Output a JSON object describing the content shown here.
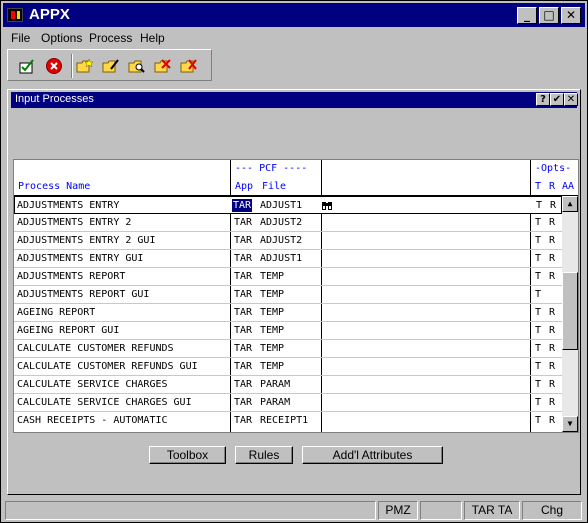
{
  "window": {
    "title": "APPX"
  },
  "menu": [
    "File",
    "Options",
    "Process",
    "Help"
  ],
  "toolbar": [
    "checkmark-icon",
    "cancel-icon",
    "folder-new-icon",
    "folder-edit-icon",
    "folder-search-icon",
    "folder-delete-icon",
    "folder-check-icon"
  ],
  "dialog": {
    "title": "Input Processes",
    "header": {
      "process_name": "Process Name",
      "pcf_group": "--- PCF ----",
      "app": "App",
      "file": "File",
      "opts_group": "-Opts-",
      "opt_t": "T",
      "opt_r": "R",
      "opt_aa": "AA"
    },
    "rows": [
      {
        "name": "ADJUSTMENTS ENTRY",
        "app": "TAR",
        "file": "ADJUST1",
        "t": "T",
        "r": "R"
      },
      {
        "name": "ADJUSTMENTS ENTRY 2",
        "app": "TAR",
        "file": "ADJUST2",
        "t": "T",
        "r": "R"
      },
      {
        "name": "ADJUSTMENTS ENTRY 2 GUI",
        "app": "TAR",
        "file": "ADJUST2",
        "t": "T",
        "r": "R"
      },
      {
        "name": "ADJUSTMENTS ENTRY GUI",
        "app": "TAR",
        "file": "ADJUST1",
        "t": "T",
        "r": "R"
      },
      {
        "name": "ADJUSTMENTS REPORT",
        "app": "TAR",
        "file": "TEMP",
        "t": "T",
        "r": "R"
      },
      {
        "name": "ADJUSTMENTS REPORT GUI",
        "app": "TAR",
        "file": "TEMP",
        "t": "T",
        "r": ""
      },
      {
        "name": "AGEING REPORT",
        "app": "TAR",
        "file": "TEMP",
        "t": "T",
        "r": "R"
      },
      {
        "name": "AGEING REPORT GUI",
        "app": "TAR",
        "file": "TEMP",
        "t": "T",
        "r": "R"
      },
      {
        "name": "CALCULATE CUSTOMER REFUNDS",
        "app": "TAR",
        "file": "TEMP",
        "t": "T",
        "r": "R"
      },
      {
        "name": "CALCULATE CUSTOMER REFUNDS GUI",
        "app": "TAR",
        "file": "TEMP",
        "t": "T",
        "r": "R"
      },
      {
        "name": "CALCULATE SERVICE CHARGES",
        "app": "TAR",
        "file": "PARAM",
        "t": "T",
        "r": "R"
      },
      {
        "name": "CALCULATE SERVICE CHARGES GUI",
        "app": "TAR",
        "file": "PARAM",
        "t": "T",
        "r": "R"
      },
      {
        "name": "CASH RECEIPTS - AUTOMATIC",
        "app": "TAR",
        "file": "RECEIPT1",
        "t": "T",
        "r": "R"
      }
    ],
    "buttons": {
      "toolbox": "Toolbox",
      "rules": "Rules",
      "attributes": "Add'l Attributes"
    }
  },
  "status": {
    "user": "PMZ",
    "app": "TAR TA",
    "mode": "Chg"
  },
  "colors": {
    "titlebar": "#000080",
    "header_text": "#0000ff",
    "face": "#c0c0c0"
  }
}
